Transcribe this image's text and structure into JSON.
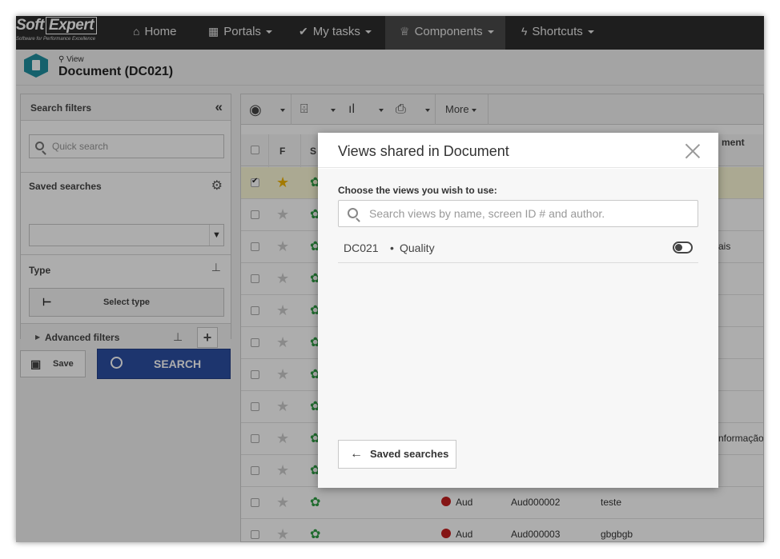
{
  "nav": {
    "logo_main": "Soft",
    "logo_box": "Expert",
    "logo_sub": "Software for Performance Excellence",
    "items": [
      {
        "label": "Home",
        "icon": "home-icon"
      },
      {
        "label": "Portals",
        "icon": "portals-icon"
      },
      {
        "label": "My tasks",
        "icon": "check-icon"
      },
      {
        "label": "Components",
        "icon": "trophy-icon"
      },
      {
        "label": "Shortcuts",
        "icon": "bolt-icon"
      }
    ],
    "active": "Components"
  },
  "header": {
    "breadcrumb": "View",
    "title": "Document (DC021)"
  },
  "left": {
    "search_filters": "Search filters",
    "quick_search_placeholder": "Quick search",
    "saved_searches": "Saved searches",
    "type_label": "Type",
    "select_type": "Select type",
    "advanced_filters": "Advanced filters",
    "save": "Save",
    "search": "SEARCH"
  },
  "toolbar": {
    "more": "More"
  },
  "grid": {
    "col_f": "F",
    "col_s": "S",
    "col_partial": "ment",
    "rows": [
      {
        "selected": true,
        "starred": true,
        "tail": ""
      },
      {
        "selected": false,
        "starred": false,
        "tail": ""
      },
      {
        "selected": false,
        "starred": false,
        "tail": "ais"
      },
      {
        "selected": false,
        "starred": false,
        "tail": ""
      },
      {
        "selected": false,
        "starred": false,
        "tail": ""
      },
      {
        "selected": false,
        "starred": false,
        "tail": ""
      },
      {
        "selected": false,
        "starred": false,
        "tail": ""
      },
      {
        "selected": false,
        "starred": false,
        "tail": ""
      },
      {
        "selected": false,
        "starred": false,
        "tail": "nformação"
      },
      {
        "selected": false,
        "starred": false,
        "tail": ""
      },
      {
        "selected": false,
        "starred": false,
        "type": "Aud",
        "id": "Aud000002",
        "title": "teste"
      },
      {
        "selected": false,
        "starred": false,
        "type": "Aud",
        "id": "Aud000003",
        "title": "gbgbgb"
      }
    ]
  },
  "modal": {
    "title": "Views shared in Document",
    "label": "Choose the views you wish to use:",
    "search_placeholder": "Search views by name, screen ID # and author.",
    "view": {
      "code": "DC021",
      "bullet": "•",
      "name": "Quality",
      "enabled": false
    },
    "back_button": "Saved searches"
  },
  "colors": {
    "nav_bg": "#2d2d2d",
    "search_button": "#2c4fa3",
    "header_icon": "#1f8f9f",
    "star_active": "#f0b400",
    "status_red": "#c41f1f"
  }
}
